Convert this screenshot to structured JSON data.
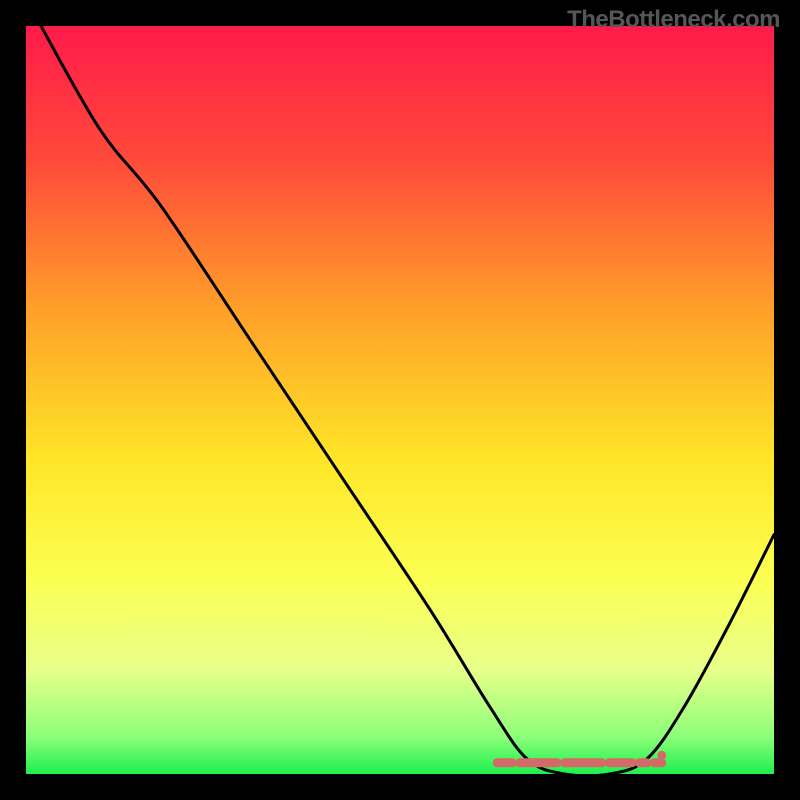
{
  "watermark": "TheBottleneck.com",
  "chart_data": {
    "type": "line",
    "title": "",
    "xlabel": "",
    "ylabel": "",
    "xlim": [
      0,
      100
    ],
    "ylim": [
      0,
      100
    ],
    "gradient_stops": [
      {
        "offset": 0,
        "color": "#ff1a4a"
      },
      {
        "offset": 18,
        "color": "#ff4a3a"
      },
      {
        "offset": 38,
        "color": "#ffa029"
      },
      {
        "offset": 58,
        "color": "#ffe627"
      },
      {
        "offset": 74,
        "color": "#fbff52"
      },
      {
        "offset": 86,
        "color": "#e8ff8a"
      },
      {
        "offset": 95,
        "color": "#8dff7a"
      },
      {
        "offset": 100,
        "color": "#1cf04e"
      }
    ],
    "curve": [
      {
        "x": 2,
        "y": 100
      },
      {
        "x": 10,
        "y": 86
      },
      {
        "x": 18,
        "y": 76
      },
      {
        "x": 30,
        "y": 58
      },
      {
        "x": 42,
        "y": 40
      },
      {
        "x": 54,
        "y": 22
      },
      {
        "x": 62,
        "y": 9
      },
      {
        "x": 67,
        "y": 2
      },
      {
        "x": 72,
        "y": 0
      },
      {
        "x": 78,
        "y": 0
      },
      {
        "x": 83,
        "y": 2
      },
      {
        "x": 88,
        "y": 9
      },
      {
        "x": 94,
        "y": 20
      },
      {
        "x": 100,
        "y": 32
      }
    ],
    "marker_band": {
      "x_start": 63,
      "x_end": 84,
      "y": 1.5,
      "color": "#d36a68",
      "segments": [
        {
          "x": 63,
          "len": 2
        },
        {
          "x": 66,
          "len": 5
        },
        {
          "x": 72,
          "len": 5
        },
        {
          "x": 78,
          "len": 3
        },
        {
          "x": 82,
          "len": 1
        },
        {
          "x": 84,
          "len": 1
        }
      ]
    }
  }
}
